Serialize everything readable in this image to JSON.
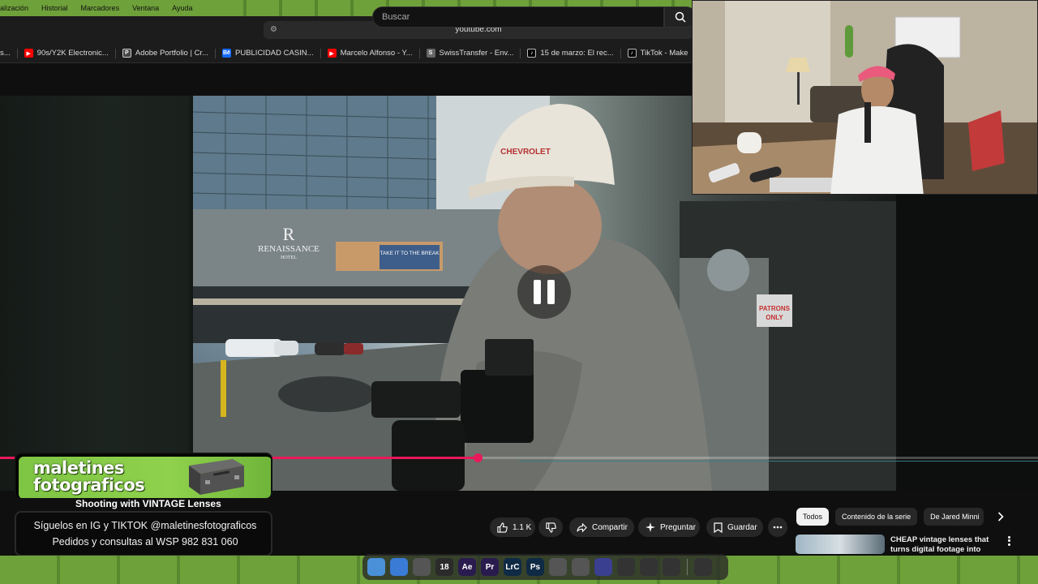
{
  "menubar": {
    "items": [
      "alización",
      "Historial",
      "Marcadores",
      "Ventana",
      "Ayuda"
    ]
  },
  "browser": {
    "url": "youtube.com",
    "bookmarks": [
      {
        "label": "s...",
        "favicon": "none",
        "color": "#1c1c1c"
      },
      {
        "label": "90s/Y2K Electronic...",
        "favicon": "youtube-icon",
        "color": "#ff0000"
      },
      {
        "label": "Adobe Portfolio | Cr...",
        "favicon": "portfolio-icon",
        "color": "#444444"
      },
      {
        "label": "PUBLICIDAD CASIN...",
        "favicon": "behance-icon",
        "color": "#1769ff"
      },
      {
        "label": "Marcelo Alfonso - Y...",
        "favicon": "youtube-icon",
        "color": "#ff0000"
      },
      {
        "label": "SwissTransfer - Env...",
        "favicon": "swisstransfer-icon",
        "color": "#666666"
      },
      {
        "label": "15 de marzo: El rec...",
        "favicon": "tiktok-icon",
        "color": "#000000"
      },
      {
        "label": "TikTok - Make",
        "favicon": "tiktok-icon",
        "color": "#000000"
      }
    ]
  },
  "youtube": {
    "search_placeholder": "Buscar",
    "video_title": "Shooting with VINTAGE Lenses",
    "like_count": "1.1 K",
    "share_label": "Compartir",
    "ask_label": "Preguntar",
    "save_label": "Guardar",
    "progress": 0.46,
    "accent": "#e8195a",
    "chips": [
      "Todos",
      "Contenido de la serie",
      "De Jared Minni"
    ],
    "recommendation": {
      "title": "CHEAP vintage lenses that turns digital footage into FILM"
    }
  },
  "video_scene": {
    "hotel_sign_letter": "R",
    "hotel_sign_name": "RENAISSANCE",
    "hotel_sign_sub": "HOTEL",
    "billboard_text": "TAKE IT TO THE BREAK",
    "cap_text": "CHEVROLET",
    "patrons_text_1": "PATRONS",
    "patrons_text_2": "ONLY"
  },
  "overlay": {
    "brand_line_1": "maletines",
    "brand_line_2": "fotograficos",
    "follow_line_1": "Síguelos en IG y TIKTOK @maletinesfotograficos",
    "follow_line_2": "Pedidos y consultas al WSP 982 831 060"
  },
  "dock": {
    "calendar_day": "18",
    "apps": [
      {
        "name": "finder-icon",
        "label": "",
        "color": "#4a90d9"
      },
      {
        "name": "safari-icon",
        "label": "",
        "color": "#3a7bd5"
      },
      {
        "name": "notes-icon",
        "label": "",
        "color": "#555555"
      },
      {
        "name": "calendar-icon",
        "label": "18",
        "color": "#2b2b2b"
      },
      {
        "name": "after-effects-icon",
        "label": "Ae",
        "color": "#2a1b4e"
      },
      {
        "name": "premiere-icon",
        "label": "Pr",
        "color": "#2a1b4e"
      },
      {
        "name": "lightroom-classic-icon",
        "label": "LrC",
        "color": "#0f2a44"
      },
      {
        "name": "photoshop-icon",
        "label": "Ps",
        "color": "#0f2a44"
      },
      {
        "name": "app-store-icon",
        "label": "",
        "color": "#555555"
      },
      {
        "name": "transfer-icon",
        "label": "",
        "color": "#555555"
      },
      {
        "name": "discord-icon",
        "label": "",
        "color": "#3b3f8f"
      },
      {
        "name": "music-icon",
        "label": "",
        "color": "#333333"
      },
      {
        "name": "activity-monitor-icon",
        "label": "",
        "color": "#333333"
      },
      {
        "name": "obs-icon",
        "label": "",
        "color": "#333333"
      },
      {
        "name": "trash-icon",
        "label": "",
        "color": "#333333"
      }
    ]
  }
}
